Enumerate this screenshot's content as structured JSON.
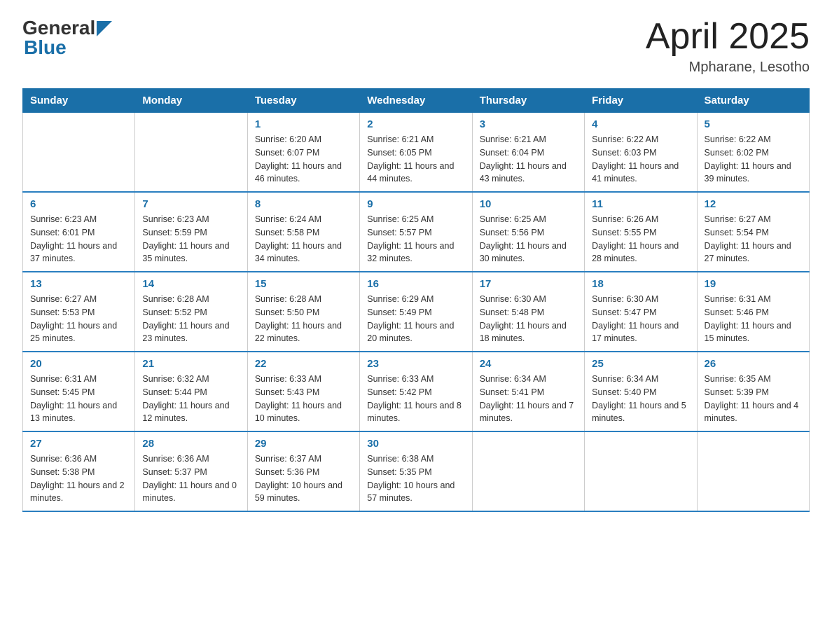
{
  "header": {
    "logo": {
      "general": "General",
      "blue": "Blue"
    },
    "title": "April 2025",
    "location": "Mpharane, Lesotho"
  },
  "days_of_week": [
    "Sunday",
    "Monday",
    "Tuesday",
    "Wednesday",
    "Thursday",
    "Friday",
    "Saturday"
  ],
  "weeks": [
    [
      {
        "day": "",
        "sunrise": "",
        "sunset": "",
        "daylight": ""
      },
      {
        "day": "",
        "sunrise": "",
        "sunset": "",
        "daylight": ""
      },
      {
        "day": "1",
        "sunrise": "Sunrise: 6:20 AM",
        "sunset": "Sunset: 6:07 PM",
        "daylight": "Daylight: 11 hours and 46 minutes."
      },
      {
        "day": "2",
        "sunrise": "Sunrise: 6:21 AM",
        "sunset": "Sunset: 6:05 PM",
        "daylight": "Daylight: 11 hours and 44 minutes."
      },
      {
        "day": "3",
        "sunrise": "Sunrise: 6:21 AM",
        "sunset": "Sunset: 6:04 PM",
        "daylight": "Daylight: 11 hours and 43 minutes."
      },
      {
        "day": "4",
        "sunrise": "Sunrise: 6:22 AM",
        "sunset": "Sunset: 6:03 PM",
        "daylight": "Daylight: 11 hours and 41 minutes."
      },
      {
        "day": "5",
        "sunrise": "Sunrise: 6:22 AM",
        "sunset": "Sunset: 6:02 PM",
        "daylight": "Daylight: 11 hours and 39 minutes."
      }
    ],
    [
      {
        "day": "6",
        "sunrise": "Sunrise: 6:23 AM",
        "sunset": "Sunset: 6:01 PM",
        "daylight": "Daylight: 11 hours and 37 minutes."
      },
      {
        "day": "7",
        "sunrise": "Sunrise: 6:23 AM",
        "sunset": "Sunset: 5:59 PM",
        "daylight": "Daylight: 11 hours and 35 minutes."
      },
      {
        "day": "8",
        "sunrise": "Sunrise: 6:24 AM",
        "sunset": "Sunset: 5:58 PM",
        "daylight": "Daylight: 11 hours and 34 minutes."
      },
      {
        "day": "9",
        "sunrise": "Sunrise: 6:25 AM",
        "sunset": "Sunset: 5:57 PM",
        "daylight": "Daylight: 11 hours and 32 minutes."
      },
      {
        "day": "10",
        "sunrise": "Sunrise: 6:25 AM",
        "sunset": "Sunset: 5:56 PM",
        "daylight": "Daylight: 11 hours and 30 minutes."
      },
      {
        "day": "11",
        "sunrise": "Sunrise: 6:26 AM",
        "sunset": "Sunset: 5:55 PM",
        "daylight": "Daylight: 11 hours and 28 minutes."
      },
      {
        "day": "12",
        "sunrise": "Sunrise: 6:27 AM",
        "sunset": "Sunset: 5:54 PM",
        "daylight": "Daylight: 11 hours and 27 minutes."
      }
    ],
    [
      {
        "day": "13",
        "sunrise": "Sunrise: 6:27 AM",
        "sunset": "Sunset: 5:53 PM",
        "daylight": "Daylight: 11 hours and 25 minutes."
      },
      {
        "day": "14",
        "sunrise": "Sunrise: 6:28 AM",
        "sunset": "Sunset: 5:52 PM",
        "daylight": "Daylight: 11 hours and 23 minutes."
      },
      {
        "day": "15",
        "sunrise": "Sunrise: 6:28 AM",
        "sunset": "Sunset: 5:50 PM",
        "daylight": "Daylight: 11 hours and 22 minutes."
      },
      {
        "day": "16",
        "sunrise": "Sunrise: 6:29 AM",
        "sunset": "Sunset: 5:49 PM",
        "daylight": "Daylight: 11 hours and 20 minutes."
      },
      {
        "day": "17",
        "sunrise": "Sunrise: 6:30 AM",
        "sunset": "Sunset: 5:48 PM",
        "daylight": "Daylight: 11 hours and 18 minutes."
      },
      {
        "day": "18",
        "sunrise": "Sunrise: 6:30 AM",
        "sunset": "Sunset: 5:47 PM",
        "daylight": "Daylight: 11 hours and 17 minutes."
      },
      {
        "day": "19",
        "sunrise": "Sunrise: 6:31 AM",
        "sunset": "Sunset: 5:46 PM",
        "daylight": "Daylight: 11 hours and 15 minutes."
      }
    ],
    [
      {
        "day": "20",
        "sunrise": "Sunrise: 6:31 AM",
        "sunset": "Sunset: 5:45 PM",
        "daylight": "Daylight: 11 hours and 13 minutes."
      },
      {
        "day": "21",
        "sunrise": "Sunrise: 6:32 AM",
        "sunset": "Sunset: 5:44 PM",
        "daylight": "Daylight: 11 hours and 12 minutes."
      },
      {
        "day": "22",
        "sunrise": "Sunrise: 6:33 AM",
        "sunset": "Sunset: 5:43 PM",
        "daylight": "Daylight: 11 hours and 10 minutes."
      },
      {
        "day": "23",
        "sunrise": "Sunrise: 6:33 AM",
        "sunset": "Sunset: 5:42 PM",
        "daylight": "Daylight: 11 hours and 8 minutes."
      },
      {
        "day": "24",
        "sunrise": "Sunrise: 6:34 AM",
        "sunset": "Sunset: 5:41 PM",
        "daylight": "Daylight: 11 hours and 7 minutes."
      },
      {
        "day": "25",
        "sunrise": "Sunrise: 6:34 AM",
        "sunset": "Sunset: 5:40 PM",
        "daylight": "Daylight: 11 hours and 5 minutes."
      },
      {
        "day": "26",
        "sunrise": "Sunrise: 6:35 AM",
        "sunset": "Sunset: 5:39 PM",
        "daylight": "Daylight: 11 hours and 4 minutes."
      }
    ],
    [
      {
        "day": "27",
        "sunrise": "Sunrise: 6:36 AM",
        "sunset": "Sunset: 5:38 PM",
        "daylight": "Daylight: 11 hours and 2 minutes."
      },
      {
        "day": "28",
        "sunrise": "Sunrise: 6:36 AM",
        "sunset": "Sunset: 5:37 PM",
        "daylight": "Daylight: 11 hours and 0 minutes."
      },
      {
        "day": "29",
        "sunrise": "Sunrise: 6:37 AM",
        "sunset": "Sunset: 5:36 PM",
        "daylight": "Daylight: 10 hours and 59 minutes."
      },
      {
        "day": "30",
        "sunrise": "Sunrise: 6:38 AM",
        "sunset": "Sunset: 5:35 PM",
        "daylight": "Daylight: 10 hours and 57 minutes."
      },
      {
        "day": "",
        "sunrise": "",
        "sunset": "",
        "daylight": ""
      },
      {
        "day": "",
        "sunrise": "",
        "sunset": "",
        "daylight": ""
      },
      {
        "day": "",
        "sunrise": "",
        "sunset": "",
        "daylight": ""
      }
    ]
  ]
}
